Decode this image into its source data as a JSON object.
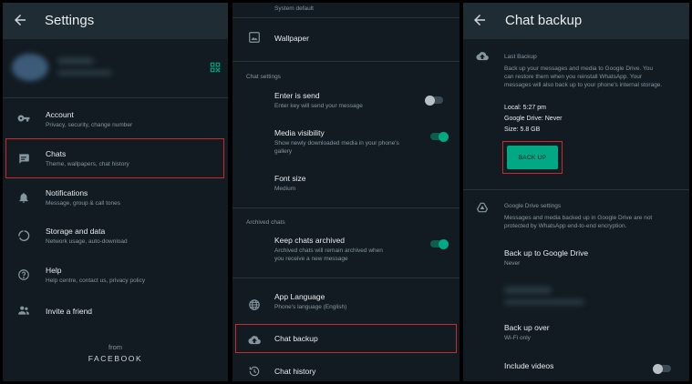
{
  "settings": {
    "title": "Settings",
    "items": [
      {
        "label": "Account",
        "sub": "Privacy, security, change number"
      },
      {
        "label": "Chats",
        "sub": "Theme, wallpapers, chat history"
      },
      {
        "label": "Notifications",
        "sub": "Message, group & call tones"
      },
      {
        "label": "Storage and data",
        "sub": "Network usage, auto-download"
      },
      {
        "label": "Help",
        "sub": "Help centre, contact us, privacy policy"
      },
      {
        "label": "Invite a friend"
      }
    ],
    "from": "from",
    "brand": "FACEBOOK"
  },
  "chats": {
    "top_sub": "System default",
    "wallpaper": "Wallpaper",
    "section_chat": "Chat settings",
    "enter_label": "Enter is send",
    "enter_sub": "Enter key will send your message",
    "enter_on": false,
    "media_label": "Media visibility",
    "media_sub1": "Show newly downloaded media in your phone's",
    "media_sub2": "gallery",
    "media_on": true,
    "font_label": "Font size",
    "font_sub": "Medium",
    "section_archived": "Archived chats",
    "keep_label": "Keep chats archived",
    "keep_sub1": "Archived chats will remain archived when",
    "keep_sub2": "you receive a new message",
    "keep_on": true,
    "lang_label": "App Language",
    "lang_sub": "Phone's language (English)",
    "backup_label": "Chat backup",
    "history_label": "Chat history"
  },
  "backup": {
    "title": "Chat backup",
    "last_title": "Last Backup",
    "desc1": "Back up your messages and media to Google Drive. You",
    "desc2": "can restore them when you reinstall WhatsApp. Your",
    "desc3": "messages will also back up to your phone's internal storage.",
    "local": "Local: 5:27 pm",
    "gdrive": "Google Drive: Never",
    "size": "Size: 5.8 GB",
    "button": "BACK UP",
    "gd_title": "Google Drive settings",
    "gd_desc1": "Messages and media backed up in Google Drive are not",
    "gd_desc2": "protected by WhatsApp end-to-end encryption.",
    "to_gd_label": "Back up to Google Drive",
    "to_gd_sub": "Never",
    "over_label": "Back up over",
    "over_sub": "Wi-Fi only",
    "videos_label": "Include videos",
    "videos_on": false
  },
  "colors": {
    "accent": "#00a884",
    "bg": "#121b22",
    "bar": "#1f2c34",
    "highlight": "#c92a2a"
  },
  "icons": [
    "back-arrow-icon",
    "qr-code-icon",
    "key-icon",
    "chat-icon",
    "bell-icon",
    "data-usage-icon",
    "help-icon",
    "people-icon",
    "wallpaper-icon",
    "globe-icon",
    "cloud-upload-icon",
    "history-icon",
    "google-drive-icon"
  ]
}
